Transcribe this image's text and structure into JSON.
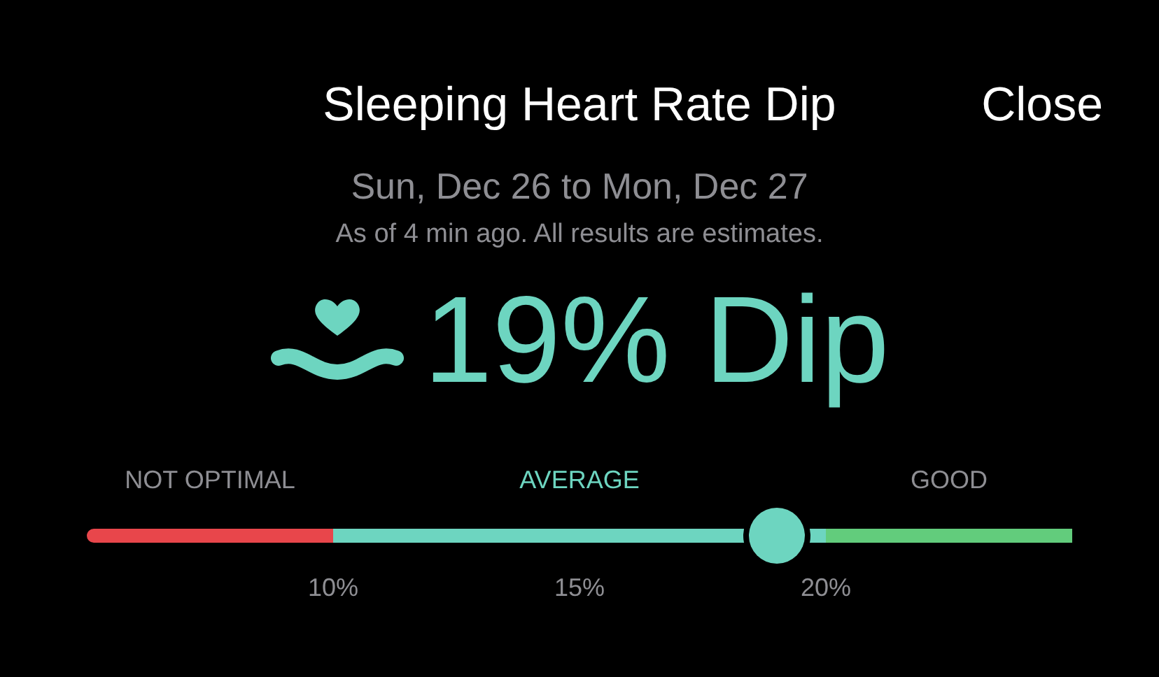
{
  "header": {
    "title": "Sleeping Heart Rate Dip",
    "close": "Close"
  },
  "summary": {
    "date_range": "Sun, Dec 26 to Mon, Dec 27",
    "note": "As of 4 min ago. All results are estimates.",
    "value": "19% Dip"
  },
  "scale": {
    "level": 0.7,
    "zones": [
      {
        "label": "NOT OPTIMAL",
        "color": "#e8464b",
        "selected": false
      },
      {
        "label": "AVERAGE",
        "color": "#6dd5c0",
        "selected": true
      },
      {
        "label": "GOOD",
        "color": "#62cc7c",
        "selected": false
      }
    ],
    "ticks": [
      "10%",
      "15%",
      "20%"
    ]
  }
}
